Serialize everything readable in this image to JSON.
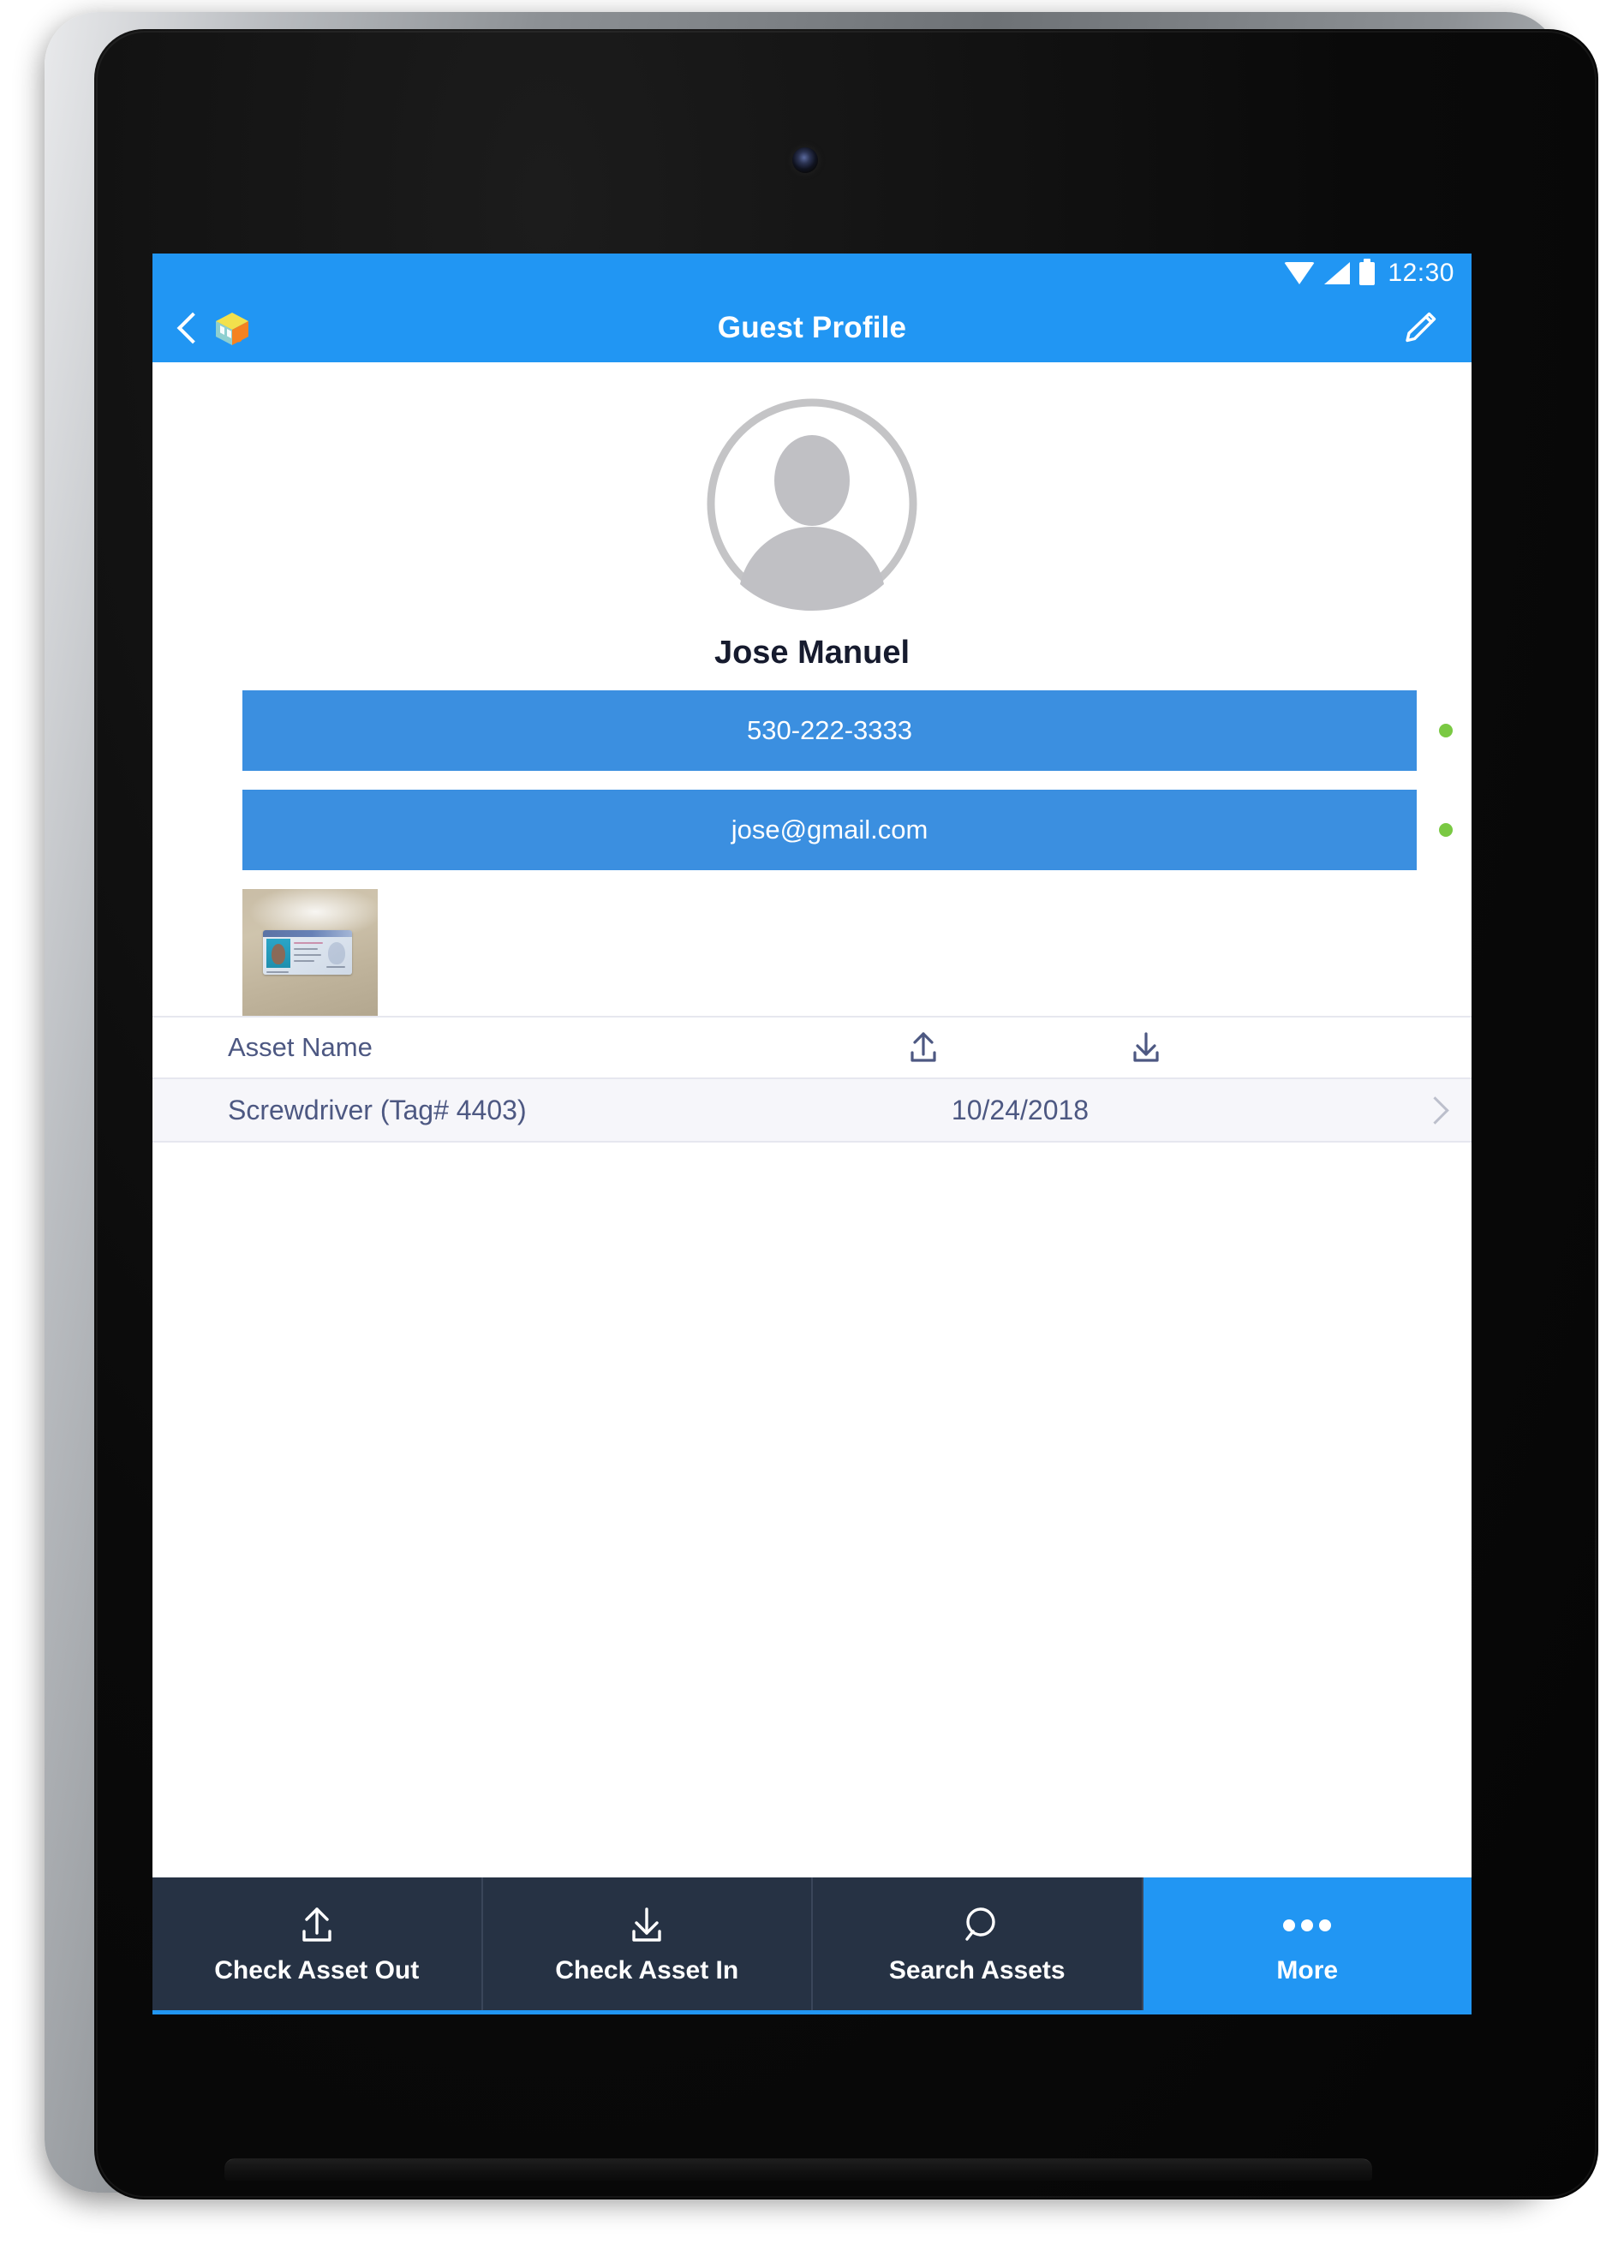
{
  "device": {
    "type": "tablet",
    "camera": "front-camera"
  },
  "status_bar": {
    "time": "12:30",
    "icons": [
      "wifi-icon",
      "cellular-signal-icon",
      "battery-icon"
    ]
  },
  "appbar": {
    "title": "Guest Profile",
    "back_icon": "back-chevron-icon",
    "logo_icon": "cube-logo-icon",
    "edit_icon": "pencil-edit-icon",
    "background_color": "#2196f3"
  },
  "profile": {
    "avatar_icon": "placeholder-avatar-icon",
    "name": "Jose Manuel",
    "contacts": [
      {
        "label": "530-222-3333",
        "type": "phone",
        "status_color": "#7ac943"
      },
      {
        "label": "jose@gmail.com",
        "type": "email",
        "status_color": "#7ac943"
      }
    ],
    "id_photo": {
      "caption": "drivers-license-photo"
    }
  },
  "asset_table": {
    "columns": [
      {
        "label": "Asset Name",
        "icon": null
      },
      {
        "label": "",
        "icon": "check-out-upload-icon"
      },
      {
        "label": "",
        "icon": "check-in-download-icon"
      }
    ],
    "rows": [
      {
        "name": "Screwdriver (Tag# 4403)",
        "date": "10/24/2018",
        "chevron": "chevron-right-icon"
      }
    ],
    "row_background": "#f6f6fa",
    "text_color": "#4d5882"
  },
  "tabbar": {
    "background_color": "#263244",
    "active_color": "#2196f3",
    "tabs": [
      {
        "label": "Check Asset Out",
        "icon": "upload-icon",
        "active": false
      },
      {
        "label": "Check Asset In",
        "icon": "download-icon",
        "active": false
      },
      {
        "label": "Search Assets",
        "icon": "search-icon",
        "active": false
      },
      {
        "label": "More",
        "icon": "more-dots-icon",
        "active": true
      }
    ]
  }
}
